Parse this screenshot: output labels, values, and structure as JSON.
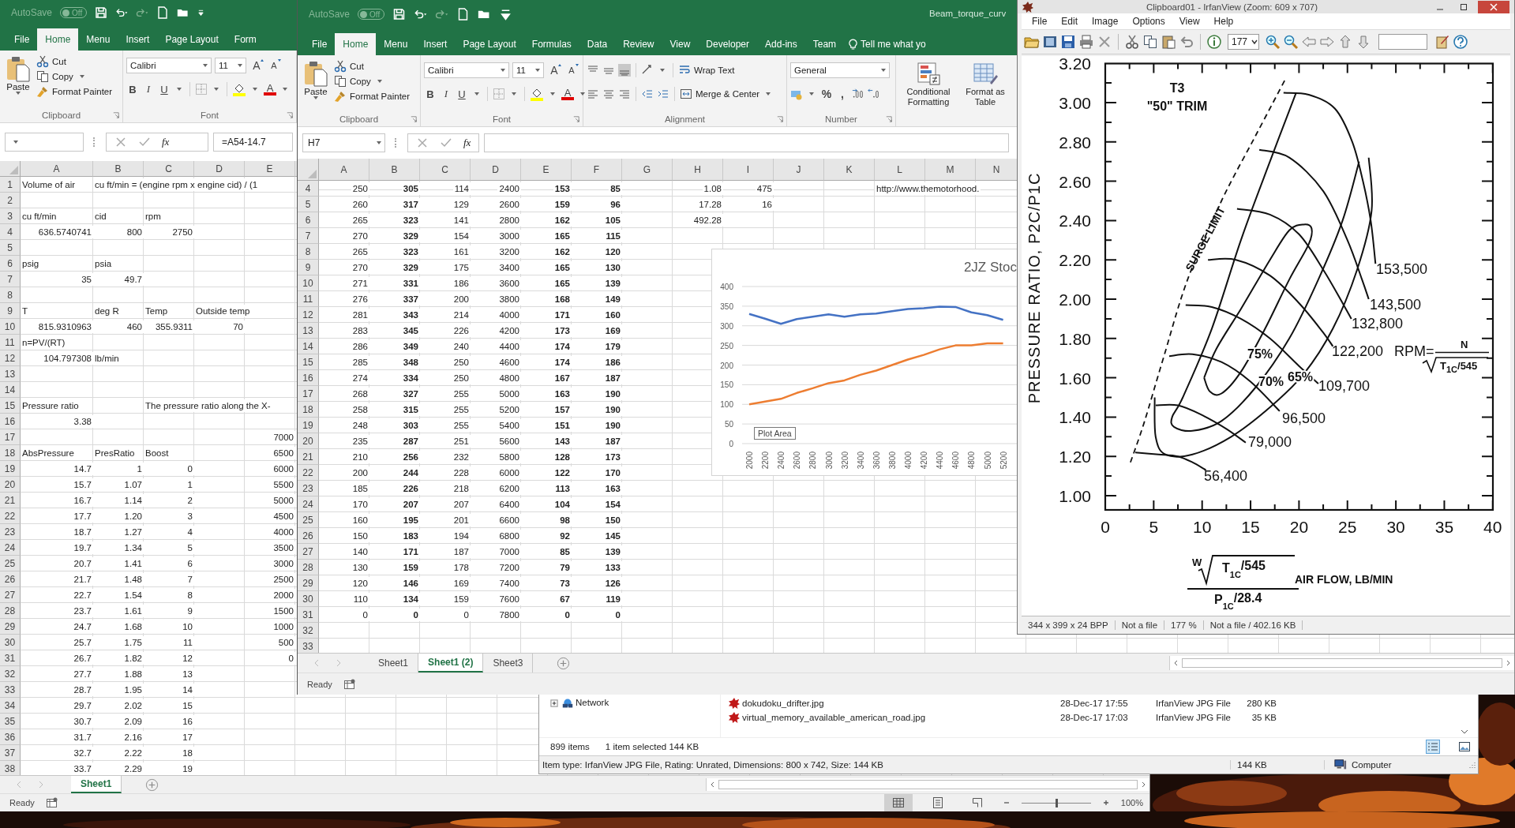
{
  "excel_windows": [
    {
      "autosave": {
        "label": "AutoSave",
        "state": "Off",
        "on": false
      },
      "tabs": [
        {
          "label": "File",
          "selected": false
        },
        {
          "label": "Home",
          "selected": true
        },
        {
          "label": "Menu",
          "selected": false
        },
        {
          "label": "Insert",
          "selected": false
        },
        {
          "label": "Page Layout",
          "selected": false
        },
        {
          "label": "Form",
          "selected": false
        }
      ],
      "groups": [
        {
          "kind": "clipboard",
          "paste": "Paste",
          "cut": "Cut",
          "copy": "Copy",
          "format_painter": "Format Painter",
          "label": "Clipboard"
        },
        {
          "kind": "font",
          "font": "Calibri",
          "size": "11",
          "grow": "A",
          "shrink": "A",
          "bold": "B",
          "italic": "I",
          "underline": "U",
          "color_letter": "A",
          "label": "Font"
        }
      ],
      "fx": "fx",
      "formula": "=A54-14.7",
      "columns": [
        {
          "label": "A",
          "bold": false
        },
        {
          "label": "B",
          "bold": false
        },
        {
          "label": "C",
          "bold": false
        },
        {
          "label": "D",
          "bold": false
        },
        {
          "label": "E",
          "bold": false
        }
      ],
      "rows": [
        {
          "n": "1",
          "cells": [
            {
              "label": "Volume of air"
            },
            {
              "label": "cu ft/min = (engine rpm x engine cid) / (1"
            }
          ]
        },
        {
          "n": "2"
        },
        {
          "n": "3",
          "cells": [
            {
              "label": "cu ft/min"
            },
            {
              "label": "cid"
            },
            {
              "label": "rpm"
            }
          ]
        },
        {
          "n": "4",
          "cells": [
            "636.5740741",
            "800",
            "2750"
          ]
        },
        {
          "n": "5"
        },
        {
          "n": "6",
          "cells": [
            {
              "label": "psig"
            },
            {
              "label": "psia"
            }
          ]
        },
        {
          "n": "7",
          "cells": [
            "35",
            "49.7"
          ]
        },
        {
          "n": "8"
        },
        {
          "n": "9",
          "cells": [
            {
              "label": "T"
            },
            {
              "label": "deg R"
            },
            {
              "label": "Temp"
            },
            {
              "label": "Outside temp"
            }
          ]
        },
        {
          "n": "10",
          "cells": [
            "815.9310963",
            "460",
            "355.9311",
            "70"
          ]
        },
        {
          "n": "11",
          "cells": [
            {
              "label": "n=PV/(RT)"
            }
          ]
        },
        {
          "n": "12",
          "cells": [
            "104.797308",
            {
              "label": "lb/min"
            }
          ]
        },
        {
          "n": "13"
        },
        {
          "n": "14"
        },
        {
          "n": "15",
          "cells": [
            {
              "label": "Pressure ratio"
            },
            null,
            {
              "label": "The pressure ratio along the X-"
            }
          ]
        },
        {
          "n": "16",
          "cells": [
            "3.38"
          ]
        },
        {
          "n": "17",
          "cells": [
            null,
            null,
            null,
            null,
            "7000"
          ]
        },
        {
          "n": "18",
          "cells": [
            {
              "label": "AbsPressure"
            },
            {
              "label": "PresRatio"
            },
            {
              "label": "Boost"
            },
            null,
            "6500"
          ]
        },
        {
          "n": "19",
          "cells": [
            "14.7",
            "1",
            "0",
            null,
            "6000"
          ]
        },
        {
          "n": "20",
          "cells": [
            "15.7",
            "1.07",
            "1",
            null,
            "5500"
          ]
        },
        {
          "n": "21",
          "cells": [
            "16.7",
            "1.14",
            "2",
            null,
            "5000"
          ]
        },
        {
          "n": "22",
          "cells": [
            "17.7",
            "1.20",
            "3",
            null,
            "4500"
          ]
        },
        {
          "n": "23",
          "cells": [
            "18.7",
            "1.27",
            "4",
            null,
            "4000"
          ]
        },
        {
          "n": "24",
          "cells": [
            "19.7",
            "1.34",
            "5",
            null,
            "3500"
          ]
        },
        {
          "n": "25",
          "cells": [
            "20.7",
            "1.41",
            "6",
            null,
            "3000"
          ]
        },
        {
          "n": "26",
          "cells": [
            "21.7",
            "1.48",
            "7",
            null,
            "2500"
          ]
        },
        {
          "n": "27",
          "cells": [
            "22.7",
            "1.54",
            "8",
            null,
            "2000"
          ]
        },
        {
          "n": "28",
          "cells": [
            "23.7",
            "1.61",
            "9",
            null,
            "1500"
          ]
        },
        {
          "n": "29",
          "cells": [
            "24.7",
            "1.68",
            "10",
            null,
            "1000"
          ]
        },
        {
          "n": "30",
          "cells": [
            "25.7",
            "1.75",
            "11",
            null,
            "500"
          ]
        },
        {
          "n": "31",
          "cells": [
            "26.7",
            "1.82",
            "12",
            null,
            "0"
          ]
        },
        {
          "n": "32",
          "cells": [
            "27.7",
            "1.88",
            "13"
          ]
        },
        {
          "n": "33",
          "cells": [
            "28.7",
            "1.95",
            "14"
          ]
        },
        {
          "n": "34",
          "cells": [
            "29.7",
            "2.02",
            "15"
          ]
        },
        {
          "n": "35",
          "cells": [
            "30.7",
            "2.09",
            "16"
          ]
        },
        {
          "n": "36",
          "cells": [
            "31.7",
            "2.16",
            "17"
          ]
        },
        {
          "n": "37",
          "cells": [
            "32.7",
            "2.22",
            "18"
          ]
        },
        {
          "n": "38",
          "cells": [
            "33.7",
            "2.29",
            "19"
          ]
        }
      ],
      "sheets": [
        {
          "label": "Sheet1",
          "selected": true
        }
      ],
      "status": "Ready",
      "zoom": {
        "level": 0.5,
        "reading": "100%"
      }
    },
    {
      "autosave": {
        "label": "AutoSave",
        "state": "Off",
        "on": false
      },
      "title": "Beam_torque_curv",
      "tell_me": "Tell me what yo",
      "tabs": [
        {
          "label": "File",
          "selected": false
        },
        {
          "label": "Home",
          "selected": true
        },
        {
          "label": "Menu",
          "selected": false
        },
        {
          "label": "Insert",
          "selected": false
        },
        {
          "label": "Page Layout",
          "selected": false
        },
        {
          "label": "Formulas",
          "selected": false
        },
        {
          "label": "Data",
          "selected": false
        },
        {
          "label": "Review",
          "selected": false
        },
        {
          "label": "View",
          "selected": false
        },
        {
          "label": "Developer",
          "selected": false
        },
        {
          "label": "Add-ins",
          "selected": false
        },
        {
          "label": "Team",
          "selected": false
        }
      ],
      "groups": [
        {
          "kind": "clipboard",
          "paste": "Paste",
          "cut": "Cut",
          "copy": "Copy",
          "format_painter": "Format Painter",
          "label": "Clipboard"
        },
        {
          "kind": "font",
          "font": "Calibri",
          "size": "11",
          "grow": "A",
          "shrink": "A",
          "bold": "B",
          "italic": "I",
          "underline": "U",
          "color_letter": "A",
          "label": "Font"
        },
        {
          "kind": "alignment",
          "wrap": "Wrap Text",
          "merge": "Merge & Center",
          "label": "Alignment"
        },
        {
          "kind": "number",
          "format": "General",
          "percent": "%",
          "comma": ",",
          "label": "Number"
        },
        {
          "kind": "styles",
          "conditional": "Conditional Formatting",
          "table": "Format as Table"
        }
      ],
      "name_box": "H7",
      "fx": "fx",
      "columns": [
        {
          "label": "A",
          "bold": false
        },
        {
          "label": "B",
          "bold": true
        },
        {
          "label": "C",
          "bold": false
        },
        {
          "label": "D",
          "bold": false
        },
        {
          "label": "E",
          "bold": true
        },
        {
          "label": "F",
          "bold": true
        },
        {
          "label": "G"
        },
        {
          "label": "H",
          "bold": false
        },
        {
          "label": "I",
          "bold": false
        },
        {
          "label": "J"
        },
        {
          "label": "K"
        },
        {
          "label": "L",
          "bold": false
        },
        {
          "label": "M"
        },
        {
          "label": "N"
        }
      ],
      "rows": [
        {
          "n": "4",
          "cells": [
            "250",
            "305",
            "114",
            "2400",
            "153",
            "85",
            null,
            "1.08",
            "475",
            null,
            null,
            {
              "label": "http://www.themotorhood."
            }
          ]
        },
        {
          "n": "5",
          "cells": [
            "260",
            "317",
            "129",
            "2600",
            "159",
            "96",
            null,
            "17.28",
            "16"
          ]
        },
        {
          "n": "6",
          "cells": [
            "265",
            "323",
            "141",
            "2800",
            "162",
            "105",
            null,
            "492.28"
          ]
        },
        {
          "n": "7",
          "cells": [
            "270",
            "329",
            "154",
            "3000",
            "165",
            "115"
          ]
        },
        {
          "n": "8",
          "cells": [
            "265",
            "323",
            "161",
            "3200",
            "162",
            "120"
          ]
        },
        {
          "n": "9",
          "cells": [
            "270",
            "329",
            "175",
            "3400",
            "165",
            "130"
          ]
        },
        {
          "n": "10",
          "cells": [
            "271",
            "331",
            "186",
            "3600",
            "165",
            "139"
          ]
        },
        {
          "n": "11",
          "cells": [
            "276",
            "337",
            "200",
            "3800",
            "168",
            "149"
          ]
        },
        {
          "n": "12",
          "cells": [
            "281",
            "343",
            "214",
            "4000",
            "171",
            "160"
          ]
        },
        {
          "n": "13",
          "cells": [
            "283",
            "345",
            "226",
            "4200",
            "173",
            "169"
          ]
        },
        {
          "n": "14",
          "cells": [
            "286",
            "349",
            "240",
            "4400",
            "174",
            "179"
          ]
        },
        {
          "n": "15",
          "cells": [
            "285",
            "348",
            "250",
            "4600",
            "174",
            "186"
          ]
        },
        {
          "n": "16",
          "cells": [
            "274",
            "334",
            "250",
            "4800",
            "167",
            "187"
          ]
        },
        {
          "n": "17",
          "cells": [
            "268",
            "327",
            "255",
            "5000",
            "163",
            "190"
          ]
        },
        {
          "n": "18",
          "cells": [
            "258",
            "315",
            "255",
            "5200",
            "157",
            "190"
          ]
        },
        {
          "n": "19",
          "cells": [
            "248",
            "303",
            "255",
            "5400",
            "151",
            "190"
          ]
        },
        {
          "n": "20",
          "cells": [
            "235",
            "287",
            "251",
            "5600",
            "143",
            "187"
          ]
        },
        {
          "n": "21",
          "cells": [
            "210",
            "256",
            "232",
            "5800",
            "128",
            "173"
          ]
        },
        {
          "n": "22",
          "cells": [
            "200",
            "244",
            "228",
            "6000",
            "122",
            "170"
          ]
        },
        {
          "n": "23",
          "cells": [
            "185",
            "226",
            "218",
            "6200",
            "113",
            "163"
          ]
        },
        {
          "n": "24",
          "cells": [
            "170",
            "207",
            "207",
            "6400",
            "104",
            "154"
          ]
        },
        {
          "n": "25",
          "cells": [
            "160",
            "195",
            "201",
            "6600",
            "98",
            "150"
          ]
        },
        {
          "n": "26",
          "cells": [
            "150",
            "183",
            "194",
            "6800",
            "92",
            "145"
          ]
        },
        {
          "n": "27",
          "cells": [
            "140",
            "171",
            "187",
            "7000",
            "85",
            "139"
          ]
        },
        {
          "n": "28",
          "cells": [
            "130",
            "159",
            "178",
            "7200",
            "79",
            "133"
          ]
        },
        {
          "n": "29",
          "cells": [
            "120",
            "146",
            "169",
            "7400",
            "73",
            "126"
          ]
        },
        {
          "n": "30",
          "cells": [
            "110",
            "134",
            "159",
            "7600",
            "67",
            "119"
          ]
        },
        {
          "n": "31",
          "cells": [
            "0",
            "0",
            "0",
            "7800",
            "0",
            "0"
          ]
        },
        {
          "n": "32"
        },
        {
          "n": "33"
        }
      ],
      "chart": {
        "tooltip": "Plot Area",
        "chart_data": {
          "type": "line",
          "title": "2JZ Stoc",
          "grid": true,
          "categories": [
            "2000",
            "2200",
            "2400",
            "2600",
            "2800",
            "3000",
            "3200",
            "3400",
            "3600",
            "3800",
            "4000",
            "4200",
            "4400",
            "4600",
            "4800",
            "5000",
            "5200"
          ],
          "ylim": [
            0,
            400
          ],
          "yticks": [
            0,
            50,
            100,
            150,
            200,
            250,
            300,
            350,
            400
          ],
          "series": [
            {
              "color": "#4472c4",
              "values": [
                330,
                318,
                305,
                317,
                323,
                329,
                323,
                329,
                331,
                337,
                343,
                345,
                349,
                348,
                334,
                327,
                315
              ]
            },
            {
              "color": "#ed7d31",
              "values": [
                100,
                107,
                114,
                129,
                141,
                154,
                161,
                175,
                186,
                200,
                214,
                226,
                240,
                250,
                250,
                255,
                255
              ]
            }
          ]
        }
      },
      "sheets": [
        {
          "label": "Sheet1",
          "selected": false
        },
        {
          "label": "Sheet1 (2)",
          "selected": true
        },
        {
          "label": "Sheet3",
          "selected": false
        }
      ],
      "status": "Ready"
    }
  ],
  "explorer": {
    "tree": "Network",
    "files": [
      {
        "name": "dokudoku_drifter.jpg",
        "date": "28-Dec-17 17:55",
        "type": "IrfanView JPG File",
        "size": "280 KB"
      },
      {
        "name": "virtual_memory_available_american_road.jpg",
        "date": "28-Dec-17 17:03",
        "type": "IrfanView JPG File",
        "size": "35 KB"
      }
    ],
    "item_count": "899 items",
    "selection": "1 item selected  144 KB",
    "details": "Item type: IrfanView JPG File, Rating: Unrated, Dimensions: 800 x 742, Size: 144 KB",
    "size": "144 KB",
    "location": "Computer"
  },
  "irfanview": {
    "title": "Clipboard01 - IrfanView (Zoom: 609 x 707)",
    "menu": [
      "File",
      "Edit",
      "Image",
      "Options",
      "View",
      "Help"
    ],
    "zoom_value": "177",
    "image": {
      "y_axis_title": "PRESSURE RATIO, P2C/P1C",
      "y_ticks": [
        "3.20",
        "3.00",
        "2.80",
        "2.60",
        "2.40",
        "2.20",
        "2.00",
        "1.80",
        "1.60",
        "1.40",
        "1.20",
        "1.00"
      ],
      "x_ticks": [
        "0",
        "5",
        "10",
        "15",
        "20",
        "25",
        "30",
        "35",
        "40"
      ],
      "trim": [
        "T3",
        "\"50\" TRIM"
      ],
      "surge_label": "SURGE LIMIT",
      "speed_lines": [
        "153,500",
        "143,500",
        "132,800",
        "122,200",
        "109,700",
        "96,500",
        "79,000",
        "56,400"
      ],
      "efficiency": [
        "75%",
        "70%",
        "65%"
      ],
      "rpm_formula": {
        "lhs": "RPM=",
        "numerator": "N",
        "var": "T",
        "sub": "1C",
        "rest": "/545"
      },
      "flow_formula": {
        "w": "W",
        "var": "T",
        "sub": "1C",
        "rest": "/545",
        "den_var": "P",
        "den_sub": "1C",
        "den_rest": "/28.4",
        "label": "AIR FLOW, LB/MIN"
      }
    },
    "status": [
      "344 x 399 x 24 BPP",
      "Not a file",
      "177 %",
      "Not a file / 402.16 KB"
    ]
  }
}
